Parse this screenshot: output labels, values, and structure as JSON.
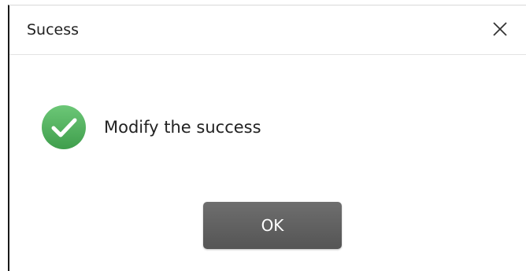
{
  "dialog": {
    "title": "Sucess",
    "close_icon": "close-icon",
    "status_icon": "check-circle-icon",
    "message": "Modify the success",
    "ok_label": "OK"
  },
  "colors": {
    "success_green": "#4cae57",
    "button_gray": "#5f5f5f",
    "text": "#222222"
  }
}
